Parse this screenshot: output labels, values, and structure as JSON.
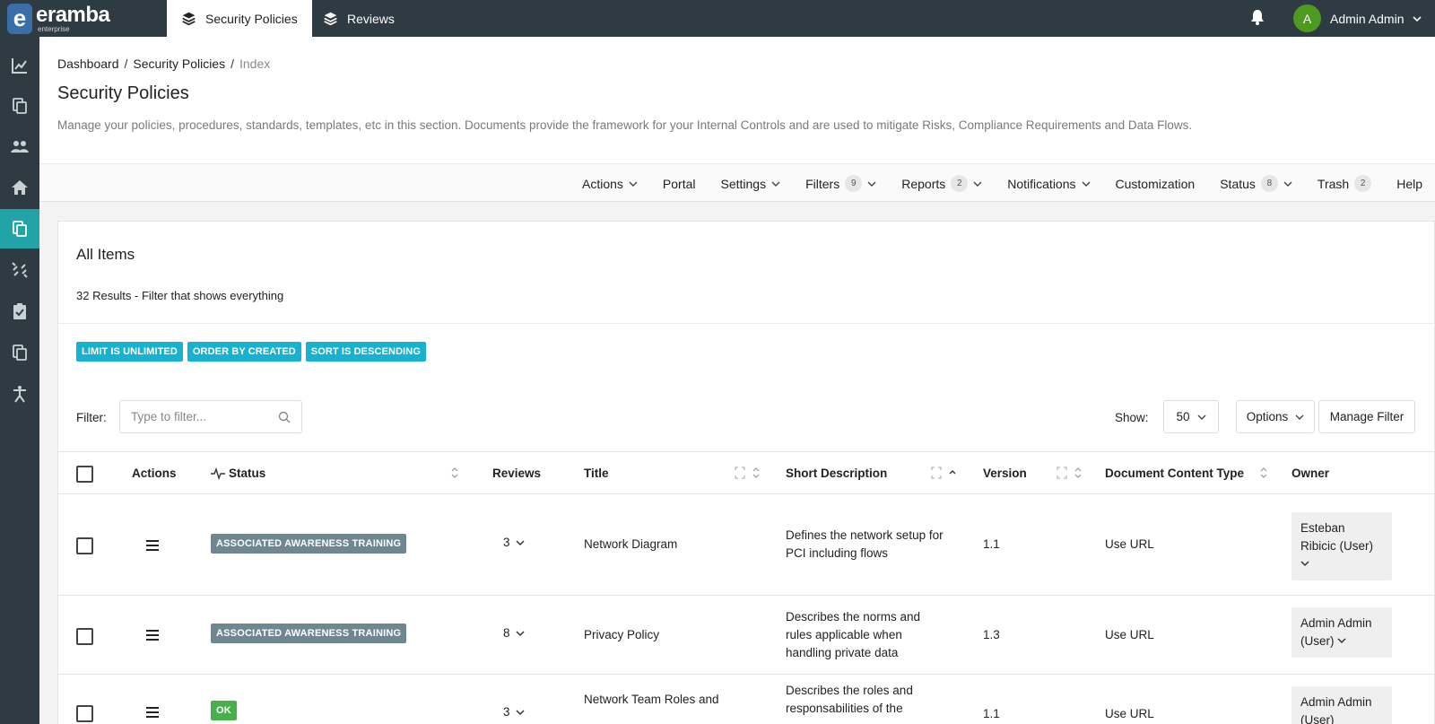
{
  "app": {
    "logo_text": "eramba",
    "logo_sub": "enterprise",
    "tabs": [
      {
        "label": "Security Policies"
      },
      {
        "label": "Reviews"
      }
    ],
    "user": {
      "initial": "A",
      "name": "Admin Admin"
    }
  },
  "breadcrumb": {
    "items": [
      "Dashboard",
      "Security Policies"
    ],
    "current": "Index",
    "separator": "/"
  },
  "page": {
    "title": "Security Policies",
    "description": "Manage your policies, procedures, standards, templates, etc in this section. Documents provide the framework for your Internal Controls and are used to mitigate Risks, Compliance Requirements and Data Flows."
  },
  "menu": {
    "actions": "Actions",
    "portal": "Portal",
    "settings": "Settings",
    "filters": "Filters",
    "filters_count": "9",
    "reports": "Reports",
    "reports_count": "2",
    "notifications": "Notifications",
    "customization": "Customization",
    "status": "Status",
    "status_count": "8",
    "trash": "Trash",
    "trash_count": "2",
    "help": "Help"
  },
  "card": {
    "title": "All Items",
    "results": "32 Results - Filter that shows everything",
    "badges": [
      "LIMIT IS UNLIMITED",
      "ORDER BY CREATED",
      "SORT IS DESCENDING"
    ],
    "filter_label": "Filter:",
    "filter_placeholder": "Type to filter...",
    "show_label": "Show:",
    "show_value": "50",
    "options_label": "Options",
    "manage_filter_label": "Manage Filter"
  },
  "table": {
    "headers": {
      "actions": "Actions",
      "status": "Status",
      "reviews": "Reviews",
      "title": "Title",
      "short_description": "Short Description",
      "version": "Version",
      "document_content_type": "Document Content Type",
      "owner": "Owner"
    },
    "rows": [
      {
        "status": "ASSOCIATED AWARENESS TRAINING",
        "reviews": "3",
        "title": "Network Diagram",
        "description": "Defines the network setup for PCI including flows",
        "version": "1.1",
        "content_type": "Use URL",
        "owner": "Esteban Ribicic (User)"
      },
      {
        "status": "ASSOCIATED AWARENESS TRAINING",
        "reviews": "8",
        "title": "Privacy Policy",
        "description": "Describes the norms and rules applicable when handling private data",
        "version": "1.3",
        "content_type": "Use URL",
        "owner": "Admin Admin (User)"
      },
      {
        "status": "OK",
        "reviews": "3",
        "title": "Network Team Roles and",
        "description": "Describes the roles and responsabilities of the",
        "version": "1.1",
        "content_type": "Use URL",
        "owner": "Admin Admin (User)"
      }
    ]
  },
  "colors": {
    "topbar": "#2e3b42",
    "sidebar_active": "#21a3a7",
    "badge_cyan": "#17b2cf",
    "status_grey": "#6e8791",
    "status_green": "#46b04a",
    "avatar": "#4c9a1f"
  }
}
